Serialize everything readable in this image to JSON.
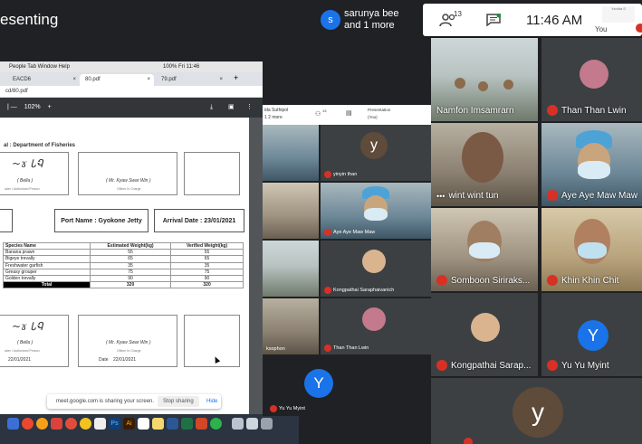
{
  "top": {
    "presenting": "esenting",
    "presenter_initial": "s",
    "presenter_line1": "sarunya bee",
    "presenter_line2": "and 1 more",
    "people_count": "13",
    "time": "11:46 AM",
    "you_label": "You"
  },
  "screen": {
    "menubar": "People   Tab   Window   Help",
    "menubar_right": "100%   Fri 11:46",
    "tabs": [
      "EACD6",
      "80.pdf",
      "79.pdf"
    ],
    "url": "cd/80.pdf",
    "zoom": "102%",
    "department": "al :   Department of Fisheries",
    "sig1_name": "( Bella )",
    "sig1_role": "ader / Authorized Person",
    "sig2_name": "( Mr. Kyaw Swar Win )",
    "sig2_role": "Officer In Charge",
    "port_name": "Port Name : Gyokone Jetty",
    "arrival_date": "Arrival Date : 23/01/2021",
    "table_headers": [
      "Species Name",
      "Estimated Weight(kg)",
      "Verified Weight(kg)"
    ],
    "table_rows": [
      [
        "Banana prawn",
        "55",
        "55"
      ],
      [
        "Bigeye trevally",
        "65",
        "65"
      ],
      [
        "Freshwater garfish",
        "35",
        "35"
      ],
      [
        "Greasy grouper",
        "75",
        "75"
      ],
      [
        "Golden trevally",
        "90",
        "90"
      ]
    ],
    "total_label": "Total",
    "total_est": "320",
    "total_ver": "320",
    "sig3_name": "( Bella )",
    "sig3_role": "ader / Authorized Person",
    "sig3_date": "22/01/2021",
    "sig4_name": "( Mr. Kyaw Swar Win )",
    "sig4_role": "Officer In Charge",
    "sig4_date_label": "Date",
    "sig4_date": "22/01/2021"
  },
  "share_bar": {
    "message": "meet.google.com is sharing your screen.",
    "stop": "Stop sharing",
    "hide": "Hide"
  },
  "mid": {
    "header_name1": "ida Suthipol",
    "header_name2": "1 2 more",
    "header_count": "13",
    "chat_tooltip": "Chat with everyone",
    "presentation_label": "Presentation",
    "presentation_you": "(You)",
    "tiles": [
      {
        "label": "yinyin than",
        "initial": "y"
      },
      {
        "label": "Aye Aye Maw Maw"
      },
      {
        "label": "Kongpathai Saraphaivanich"
      },
      {
        "label": "ksophon"
      },
      {
        "label": "Than Than Lwin"
      },
      {
        "label": "Yu Yu Myint",
        "initial": "Y"
      }
    ]
  },
  "grid": [
    {
      "label": "Namfon Imsamrarn"
    },
    {
      "label": "Than Than Lwin"
    },
    {
      "label": "wint wint tun"
    },
    {
      "label": "Aye Aye Maw Maw"
    },
    {
      "label": "Somboon Siriraks..."
    },
    {
      "label": "Khin Khin Chit"
    },
    {
      "label": "Kongpathai Sarap..."
    },
    {
      "label": "Yu Yu Myint",
      "initial": "Y"
    },
    {
      "label": "",
      "initial": "y"
    }
  ],
  "colors": {
    "mic_off": "#d93025",
    "avatar_blue": "#1a73e8",
    "avatar_y": "#5f4b3a",
    "meet_bg": "#202124"
  }
}
